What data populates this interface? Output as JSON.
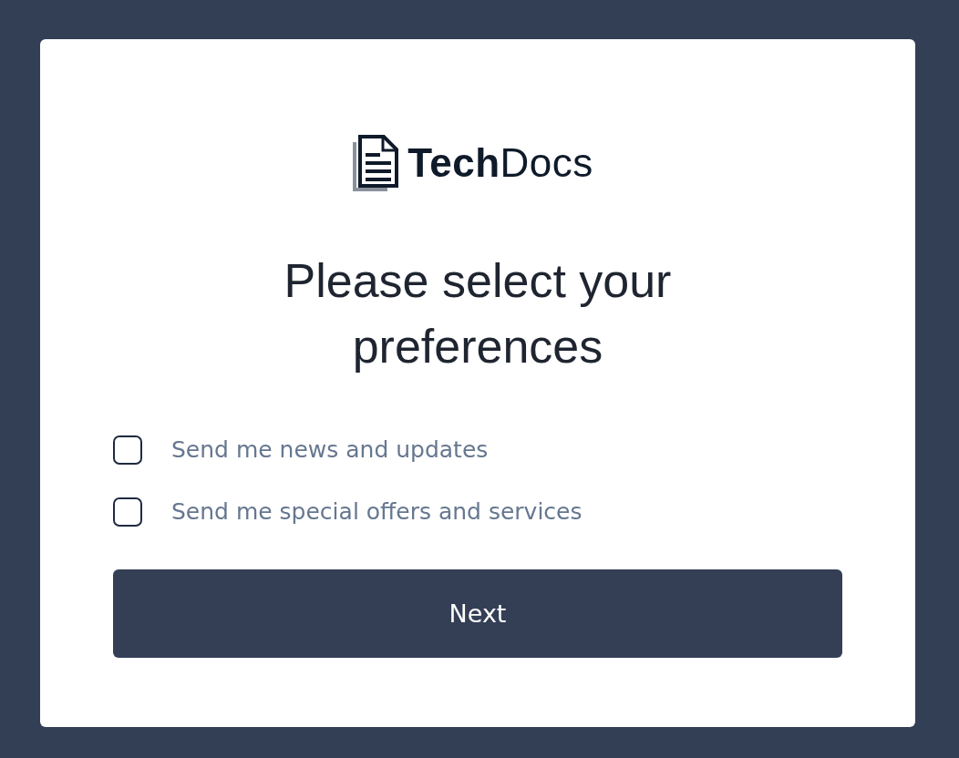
{
  "logo": {
    "text": "**Tech**Docs"
  },
  "heading": "Please select your preferences",
  "preferences": [
    {
      "label": "Send me news and updates",
      "checked": false
    },
    {
      "label": "Send me special offers and services",
      "checked": false
    }
  ],
  "button": {
    "label": "Next"
  }
}
